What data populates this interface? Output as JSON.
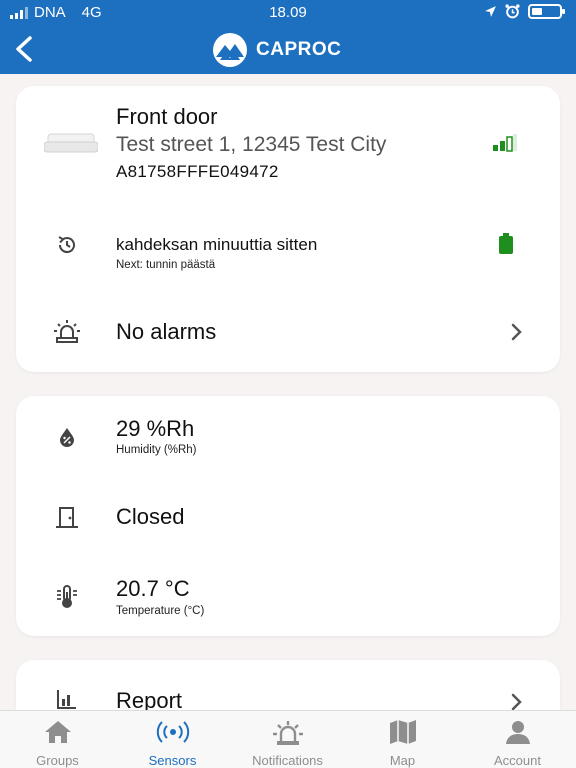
{
  "status_bar": {
    "carrier": "DNA",
    "network": "4G",
    "time": "18.09"
  },
  "header": {
    "brand": "CAPROC",
    "back_icon": "chevron-left-icon",
    "logo_icon": "mountain-logo-icon"
  },
  "sensor": {
    "name": "Front door",
    "address": "Test street 1, 12345 Test City",
    "id": "A81758FFFE049472",
    "signal_color": "#1e8f1e",
    "last_seen": "kahdeksan minuuttia sitten",
    "next": "Next: tunnin päästä",
    "battery_color": "#1e8f1e",
    "alarms": "No alarms"
  },
  "readings": [
    {
      "value": "29 %Rh",
      "label": "Humidity (%Rh)",
      "icon": "humidity-icon"
    },
    {
      "value": "Closed",
      "label": "",
      "icon": "door-icon"
    },
    {
      "value": "20.7 °C",
      "label": "Temperature (°C)",
      "icon": "thermometer-icon"
    }
  ],
  "report": {
    "label": "Report",
    "icon": "bar-chart-icon"
  },
  "tabs": [
    {
      "label": "Groups",
      "icon": "home-icon",
      "active": false
    },
    {
      "label": "Sensors",
      "icon": "broadcast-icon",
      "active": true
    },
    {
      "label": "Notifications",
      "icon": "alarm-light-icon",
      "active": false
    },
    {
      "label": "Map",
      "icon": "map-icon",
      "active": false
    },
    {
      "label": "Account",
      "icon": "person-icon",
      "active": false
    }
  ],
  "colors": {
    "primary": "#1d6fc0",
    "background": "#f7f3f3",
    "tab_inactive": "#8e8e8e"
  }
}
